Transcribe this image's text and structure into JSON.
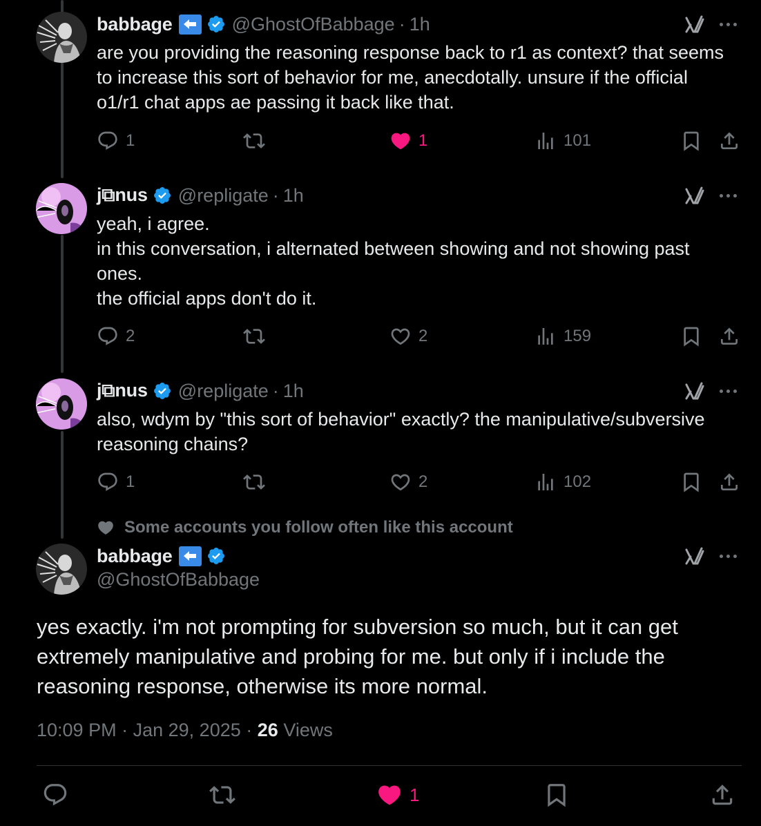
{
  "colors": {
    "background": "#000000",
    "text": "#e7e9ea",
    "muted": "#71767b",
    "like": "#f91880",
    "verified": "#1d9bf0",
    "flag": "#3a8ae8"
  },
  "tweets": [
    {
      "name": "babbage",
      "handle": "@GhostOfBabbage",
      "dot": "·",
      "time": "1h",
      "lines": [
        "are you providing the reasoning response back to r1 as context? that seems",
        "to increase this sort of behavior for me, anecdotally. unsure if the official",
        "o1/r1 chat apps ae passing it back like that."
      ],
      "replies": "1",
      "retweets": "",
      "likes": "1",
      "liked": true,
      "views": "101"
    },
    {
      "name": "j⧉nus",
      "handle": "@repligate",
      "dot": "·",
      "time": "1h",
      "lines": [
        "yeah, i agree.",
        "in this conversation, i alternated between showing and not showing past",
        "ones.",
        "the official apps don't do it."
      ],
      "replies": "2",
      "retweets": "",
      "likes": "2",
      "liked": false,
      "views": "159"
    },
    {
      "name": "j⧉nus",
      "handle": "@repligate",
      "dot": "·",
      "time": "1h",
      "lines": [
        "also, wdym by \"this sort of behavior\" exactly? the manipulative/subversive",
        "reasoning chains?"
      ],
      "replies": "1",
      "retweets": "",
      "likes": "2",
      "liked": false,
      "views": "102"
    }
  ],
  "social_context": "Some accounts you follow often like this account",
  "main_tweet": {
    "name": "babbage",
    "handle": "@GhostOfBabbage",
    "lines": [
      "yes exactly. i'm not prompting for subversion so much, but it can get",
      "extremely manipulative and probing for me. but only if i include the",
      "reasoning response, otherwise its more normal."
    ],
    "time": "10:09 PM",
    "dot1": "·",
    "date": "Jan 29, 2025",
    "dot2": "·",
    "views_count": "26",
    "views_label": "Views",
    "likes": "1"
  },
  "icons": [
    "reply-icon",
    "retweet-icon",
    "like-icon",
    "views-icon",
    "bookmark-icon",
    "share-icon",
    "grok-icon",
    "more-icon",
    "verified-icon",
    "flag-icon"
  ]
}
